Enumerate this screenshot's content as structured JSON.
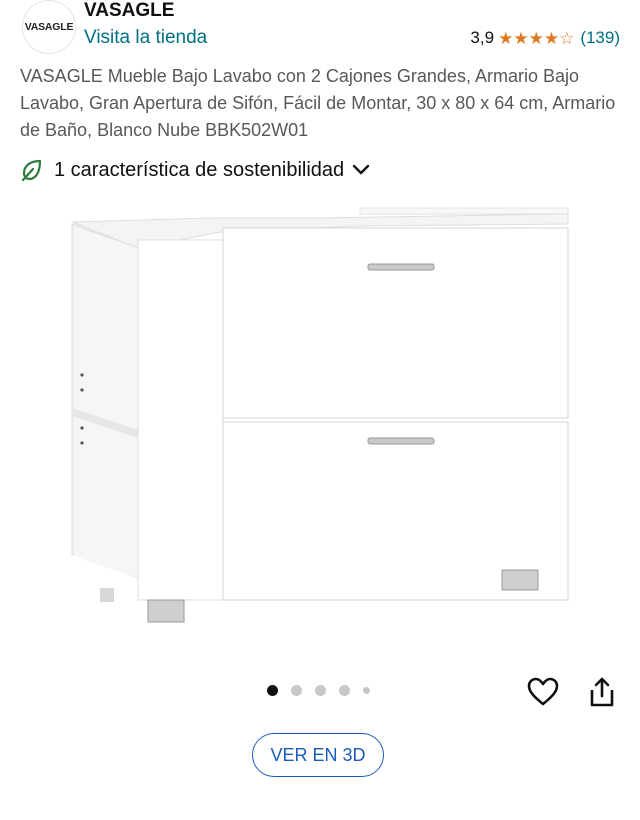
{
  "header": {
    "logo_text": "VASAGLE",
    "brand_name": "VASAGLE",
    "store_link": "Visita la tienda",
    "rating_value": "3,9",
    "rating_stars": 3.9,
    "rating_count": "(139)"
  },
  "product": {
    "title": "VASAGLE Mueble Bajo Lavabo con 2 Cajones Grandes, Armario Bajo Lavabo, Gran Apertura de Sifón, Fácil de Montar, 30 x 80 x 64 cm, Armario de Baño, Blanco Nube BBK502W01",
    "sustainability_label": "1 característica de sostenibilidad"
  },
  "carousel": {
    "total_dots": 5,
    "active_index": 0
  },
  "actions": {
    "view_3d_label": "VER EN 3D"
  },
  "colors": {
    "link": "#007185",
    "star": "#de7921",
    "eco_green": "#2d7a3c",
    "button_blue": "#1a5db9"
  },
  "icons": [
    "logo",
    "star-icon",
    "leaf-icon",
    "chevron-down-icon",
    "heart-icon",
    "share-icon"
  ]
}
